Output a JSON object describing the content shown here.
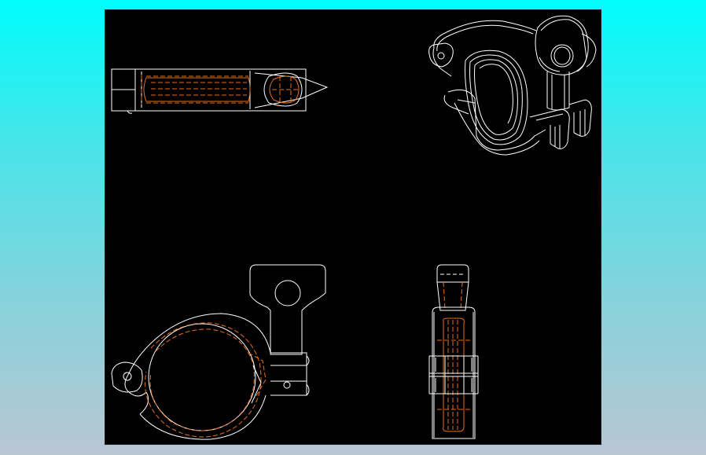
{
  "viewport": {
    "background": "#000000",
    "line_colors": {
      "visible_edges": "#ffffff",
      "hidden_edges": "#e8701e"
    }
  },
  "views": [
    {
      "id": "top-view"
    },
    {
      "id": "isometric-view"
    },
    {
      "id": "front-view"
    },
    {
      "id": "side-view"
    }
  ]
}
